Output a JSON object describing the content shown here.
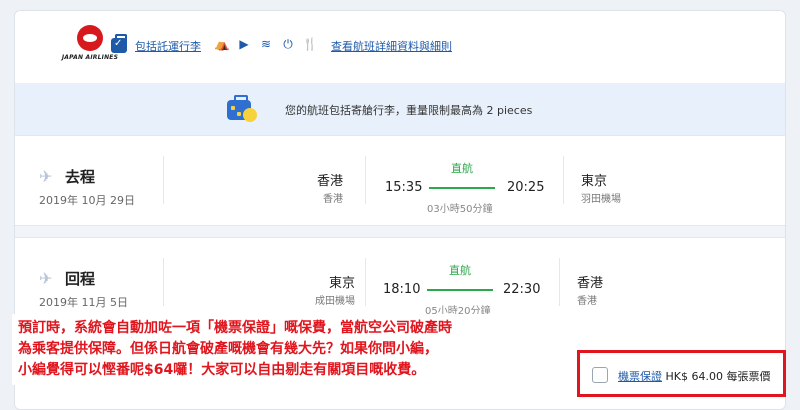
{
  "header": {
    "airline_logo_text": "JAPAN AIRLINES",
    "baggage_label": "包括託運行李",
    "amenities": [
      {
        "icon": "seat-icon",
        "glyph": "⛺"
      },
      {
        "icon": "entertainment-icon",
        "glyph": "▶"
      },
      {
        "icon": "wifi-icon",
        "glyph": "≋"
      },
      {
        "icon": "power-icon",
        "glyph": "⏻"
      },
      {
        "icon": "meal-icon",
        "glyph": "🍴"
      }
    ],
    "details_link": "查看航班詳細資料與細則"
  },
  "banner": {
    "text": "您的航班包括寄艙行李，重量限制最高為 2 pieces"
  },
  "outbound": {
    "label": "去程",
    "date": "2019年 10月 29日",
    "from_city": "香港",
    "from_airport": "香港",
    "depart_time": "15:35",
    "stops": "直航",
    "arrive_time": "20:25",
    "duration": "03小時50分鐘",
    "to_city": "東京",
    "to_airport": "羽田機場"
  },
  "return": {
    "label": "回程",
    "date": "2019年 11月 5日",
    "from_city": "東京",
    "from_airport": "成田機場",
    "depart_time": "18:10",
    "stops": "直航",
    "arrive_time": "22:30",
    "duration": "05小時20分鐘",
    "to_city": "香港",
    "to_airport": "香港"
  },
  "annotation": {
    "line1": "預訂時，系統會自動加咗一項「機票保證」嘅保費，當航空公司破產時",
    "line2": "為乘客提供保障。但係日航會破產嘅機會有幾大先？如果你問小編，",
    "line3": "小編覺得可以慳番呢$64囉！大家可以自由剔走有關項目嘅收費。"
  },
  "insurance": {
    "link_text": "機票保證",
    "price_text": "HK$ 64.00 每張票價",
    "checked": false
  },
  "colors": {
    "accent_blue": "#1e5aa8",
    "nonstop_green": "#2aa84a",
    "annotation_red": "#e0151d",
    "banner_bg": "#e8f1fb"
  }
}
